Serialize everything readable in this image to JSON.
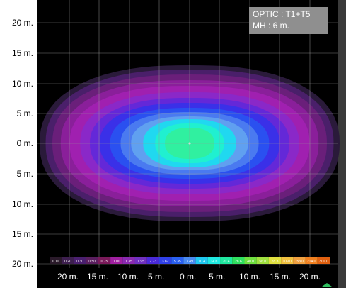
{
  "info_box": {
    "optic": "OPTIC : T1+T5",
    "mounting_height": "MH : 6 m."
  },
  "y_axis_labels": [
    "20 m.",
    "15 m.",
    "10 m.",
    "5 m.",
    "0 m.",
    "5 m.",
    "10 m.",
    "15 m.",
    "20 m."
  ],
  "x_axis_labels": [
    "20 m.",
    "15 m.",
    "10 m.",
    "5 m.",
    "0 m.",
    "5 m.",
    "10 m.",
    "15 m.",
    "20 m."
  ],
  "legend": [
    {
      "label": "0.10",
      "color": "#2a1a2a"
    },
    {
      "label": "0.20",
      "color": "#3d1f4f"
    },
    {
      "label": "0.30",
      "color": "#4a1f6f"
    },
    {
      "label": "0.50",
      "color": "#5a1f5f"
    },
    {
      "label": "0.75",
      "color": "#7a1a5a"
    },
    {
      "label": "1.00",
      "color": "#a020a0"
    },
    {
      "label": "1.35",
      "color": "#8a2ab0"
    },
    {
      "label": "1.95",
      "color": "#7030c0"
    },
    {
      "label": "2.73",
      "color": "#4a2ad8"
    },
    {
      "label": "3.82",
      "color": "#3040e8"
    },
    {
      "label": "5.35",
      "color": "#2a60f0"
    },
    {
      "label": "7.49",
      "color": "#4a8af0"
    },
    {
      "label": "10.4",
      "color": "#20c8f0"
    },
    {
      "label": "14.6",
      "color": "#20e8e0"
    },
    {
      "label": "20.4",
      "color": "#20e8a0"
    },
    {
      "label": "28.6",
      "color": "#30e060"
    },
    {
      "label": "40.0",
      "color": "#70e040"
    },
    {
      "label": "56.0",
      "color": "#a0e040"
    },
    {
      "label": "78.3",
      "color": "#e0e040"
    },
    {
      "label": "109.0",
      "color": "#f0c040"
    },
    {
      "label": "153.0",
      "color": "#f0a040"
    },
    {
      "label": "214.0",
      "color": "#f08020"
    },
    {
      "label": "300.0",
      "color": "#e06010"
    }
  ],
  "contours": [
    {
      "color": "#2a1a3a",
      "rx": 200,
      "ry": 110
    },
    {
      "color": "#4a1f6a",
      "rx": 192,
      "ry": 104
    },
    {
      "color": "#6a1f7a",
      "rx": 183,
      "ry": 97
    },
    {
      "color": "#8a1f9a",
      "rx": 172,
      "ry": 89
    },
    {
      "color": "#a020b0",
      "rx": 160,
      "ry": 81
    },
    {
      "color": "#8a28c8",
      "rx": 146,
      "ry": 72
    },
    {
      "color": "#6428d8",
      "rx": 133,
      "ry": 64
    },
    {
      "color": "#3a30e8",
      "rx": 120,
      "ry": 57
    },
    {
      "color": "#2a50f0",
      "rx": 106,
      "ry": 50
    },
    {
      "color": "#4a7af0",
      "rx": 92,
      "ry": 44
    },
    {
      "color": "#60a0f0",
      "rx": 78,
      "ry": 38
    },
    {
      "color": "#20d8f0",
      "rx": 62,
      "ry": 34
    },
    {
      "color": "#20f0d0",
      "rx": 46,
      "ry": 28
    },
    {
      "color": "#30f0a0",
      "rx": 33,
      "ry": 22
    }
  ]
}
